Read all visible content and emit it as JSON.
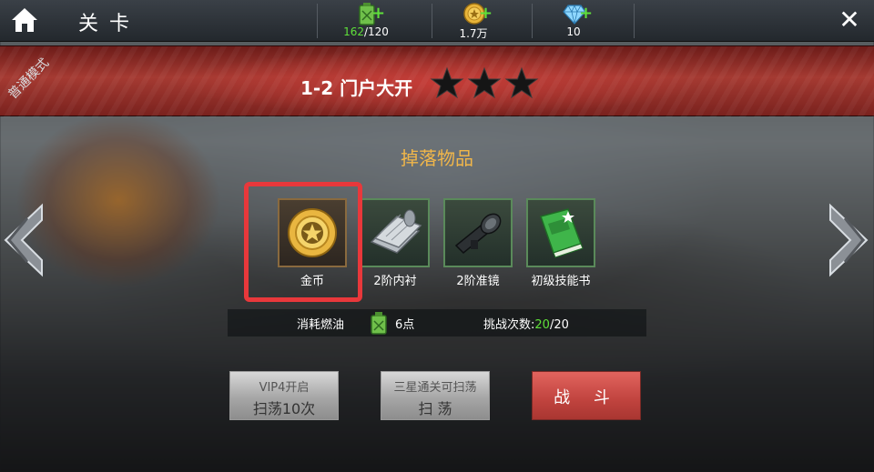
{
  "header": {
    "title": "关卡",
    "resources": [
      {
        "icon": "fuel-can-icon",
        "current": "162",
        "max": "/120"
      },
      {
        "icon": "gold-coin-icon",
        "value": "1.7万"
      },
      {
        "icon": "diamond-icon",
        "value": "10"
      }
    ]
  },
  "mode_label": "普通模式",
  "stage": {
    "name": "1-2 门户大开",
    "stars": 3
  },
  "drops": {
    "title": "掉落物品",
    "items": [
      {
        "label": "金币",
        "icon": "gold-coin-icon"
      },
      {
        "label": "2阶内衬",
        "icon": "armor-lining-icon"
      },
      {
        "label": "2阶准镜",
        "icon": "scope-icon"
      },
      {
        "label": "初级技能书",
        "icon": "skill-book-icon"
      }
    ]
  },
  "info": {
    "fuel_label": "消耗燃油",
    "fuel_cost": "6点",
    "challenge_label": "挑战次数:",
    "challenge_current": "20",
    "challenge_max": "/20"
  },
  "buttons": {
    "sweep10_line1": "VIP4开启",
    "sweep10_line2": "扫荡10次",
    "sweep_line1": "三星通关可扫荡",
    "sweep_line2": "扫 荡",
    "battle": "战 斗"
  },
  "colors": {
    "accent_green": "#5fe03a",
    "drop_title": "#f0b64a",
    "banner_red": "#a53a32",
    "highlight_red": "#e8383b"
  }
}
